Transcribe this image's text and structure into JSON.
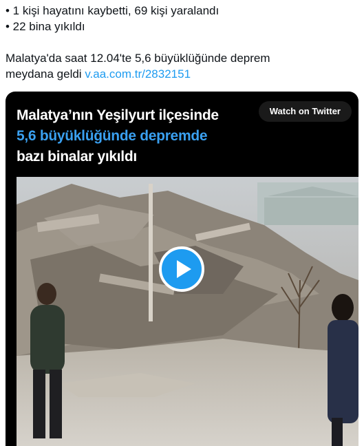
{
  "tweet": {
    "bullet1": "• 1 kişi hayatını kaybetti, 69 kişi yaralandı",
    "bullet2": "• 22 bina yıkıldı",
    "line3": "Malatya'da saat 12.04'te 5,6 büyüklüğünde deprem",
    "line4_text": "meydana geldi ",
    "link": "v.aa.com.tr/2832151"
  },
  "media": {
    "title_line1": "Malatya’nın Yeşilyurt ilçesinde",
    "title_line2": "5,6 büyüklüğünde depremde",
    "title_line3": "bazı binalar yıkıldı",
    "watch_label": "Watch on Twitter",
    "play_icon": "play-icon"
  },
  "colors": {
    "link": "#1d9bf0",
    "title_accent": "#3aa0f0",
    "play_button": "#1d9bf0"
  }
}
